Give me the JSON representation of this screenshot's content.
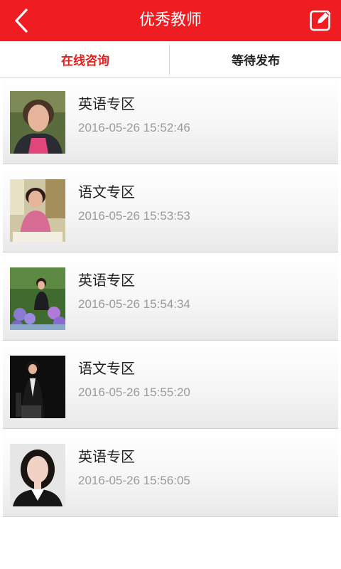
{
  "header": {
    "title": "优秀教师",
    "back_icon": "chevron-left-icon",
    "edit_icon": "edit-icon",
    "bg_color": "#ef1c22"
  },
  "tabs": [
    {
      "label": "在线咨询",
      "active": true
    },
    {
      "label": "等待发布",
      "active": false
    }
  ],
  "accent_color": "#e0231f",
  "teachers": [
    {
      "title": "英语专区",
      "time": "2016-05-26 15:52:46"
    },
    {
      "title": "语文专区",
      "time": "2016-05-26 15:53:53"
    },
    {
      "title": "英语专区",
      "time": "2016-05-26 15:54:34"
    },
    {
      "title": "语文专区",
      "time": "2016-05-26 15:55:20"
    },
    {
      "title": "英语专区",
      "time": "2016-05-26 15:56:05"
    }
  ]
}
